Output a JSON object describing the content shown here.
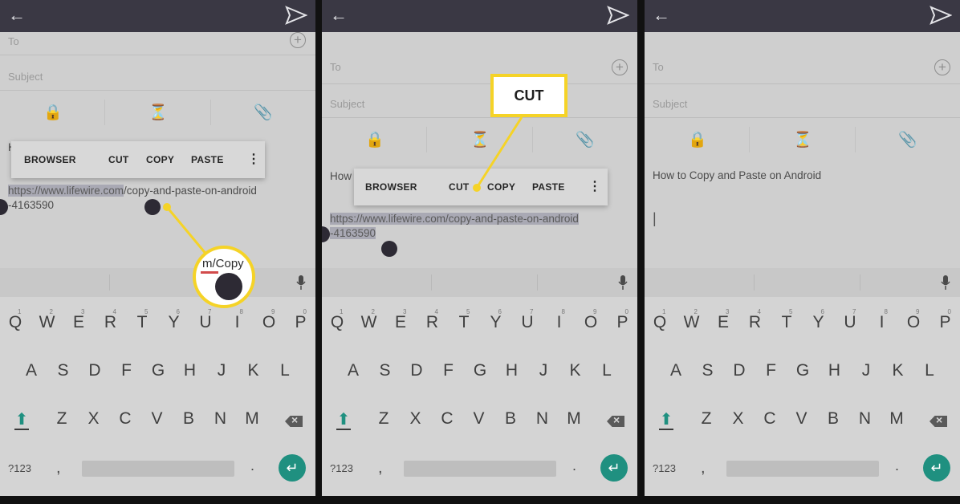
{
  "panels": [
    {
      "to_label": "To",
      "subject_label": "Subject",
      "menu": {
        "browser": "BROWSER",
        "cut": "CUT",
        "copy": "COPY",
        "paste": "PASTE",
        "more": "⋮"
      },
      "body_prefix": "H",
      "url_selected": "https://www.lifewire.com",
      "url_rest": "/copy-and-paste-on-android",
      "url_line2": "-4163590",
      "zoom_text": "m/Copy"
    },
    {
      "to_label": "To",
      "subject_label": "Subject",
      "menu": {
        "browser": "BROWSER",
        "cut": "CUT",
        "copy": "COPY",
        "paste": "PASTE",
        "more": "⋮"
      },
      "body_prefix": "How",
      "url_line1": "https://www.lifewire.com/copy-and-paste-on-android",
      "url_line2": "-4163590",
      "callout": "CUT"
    },
    {
      "to_label": "To",
      "subject_label": "Subject",
      "body_line": "How to Copy and Paste on Android",
      "cursor": "|"
    }
  ],
  "keyboard": {
    "row1": [
      "Q",
      "W",
      "E",
      "R",
      "T",
      "Y",
      "U",
      "I",
      "O",
      "P"
    ],
    "row1_hints": [
      "1",
      "2",
      "3",
      "4",
      "5",
      "6",
      "7",
      "8",
      "9",
      "0"
    ],
    "row2": [
      "A",
      "S",
      "D",
      "F",
      "G",
      "H",
      "J",
      "K",
      "L"
    ],
    "row3": [
      "Z",
      "X",
      "C",
      "V",
      "B",
      "N",
      "M"
    ],
    "symbols_key": "?123",
    "comma": ",",
    "period": "."
  },
  "colors": {
    "topbar": "#3a3844",
    "accent": "#1f9080",
    "highlight": "#f5d327"
  }
}
